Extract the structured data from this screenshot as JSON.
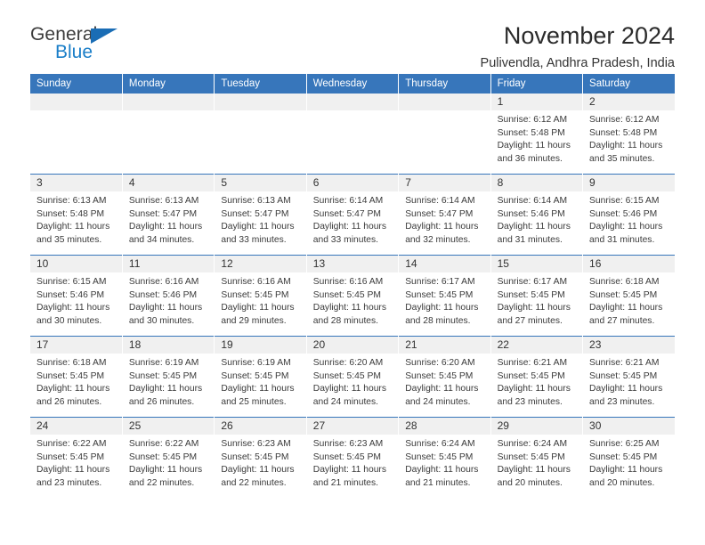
{
  "brand": {
    "name_top": "General",
    "name_bottom": "Blue",
    "triangle_color": "#1a6db5",
    "blue_color": "#1a7ec8"
  },
  "header": {
    "title": "November 2024",
    "subtitle": "Pulivendla, Andhra Pradesh, India"
  },
  "theme": {
    "header_blue": "#3776bb",
    "band_gray": "#f0f0f0"
  },
  "weekday_headers": [
    "Sunday",
    "Monday",
    "Tuesday",
    "Wednesday",
    "Thursday",
    "Friday",
    "Saturday"
  ],
  "weeks": [
    [
      {
        "day": "",
        "sunrise": "",
        "sunset": "",
        "daylight1": "",
        "daylight2": ""
      },
      {
        "day": "",
        "sunrise": "",
        "sunset": "",
        "daylight1": "",
        "daylight2": ""
      },
      {
        "day": "",
        "sunrise": "",
        "sunset": "",
        "daylight1": "",
        "daylight2": ""
      },
      {
        "day": "",
        "sunrise": "",
        "sunset": "",
        "daylight1": "",
        "daylight2": ""
      },
      {
        "day": "",
        "sunrise": "",
        "sunset": "",
        "daylight1": "",
        "daylight2": ""
      },
      {
        "day": "1",
        "sunrise": "Sunrise: 6:12 AM",
        "sunset": "Sunset: 5:48 PM",
        "daylight1": "Daylight: 11 hours",
        "daylight2": "and 36 minutes."
      },
      {
        "day": "2",
        "sunrise": "Sunrise: 6:12 AM",
        "sunset": "Sunset: 5:48 PM",
        "daylight1": "Daylight: 11 hours",
        "daylight2": "and 35 minutes."
      }
    ],
    [
      {
        "day": "3",
        "sunrise": "Sunrise: 6:13 AM",
        "sunset": "Sunset: 5:48 PM",
        "daylight1": "Daylight: 11 hours",
        "daylight2": "and 35 minutes."
      },
      {
        "day": "4",
        "sunrise": "Sunrise: 6:13 AM",
        "sunset": "Sunset: 5:47 PM",
        "daylight1": "Daylight: 11 hours",
        "daylight2": "and 34 minutes."
      },
      {
        "day": "5",
        "sunrise": "Sunrise: 6:13 AM",
        "sunset": "Sunset: 5:47 PM",
        "daylight1": "Daylight: 11 hours",
        "daylight2": "and 33 minutes."
      },
      {
        "day": "6",
        "sunrise": "Sunrise: 6:14 AM",
        "sunset": "Sunset: 5:47 PM",
        "daylight1": "Daylight: 11 hours",
        "daylight2": "and 33 minutes."
      },
      {
        "day": "7",
        "sunrise": "Sunrise: 6:14 AM",
        "sunset": "Sunset: 5:47 PM",
        "daylight1": "Daylight: 11 hours",
        "daylight2": "and 32 minutes."
      },
      {
        "day": "8",
        "sunrise": "Sunrise: 6:14 AM",
        "sunset": "Sunset: 5:46 PM",
        "daylight1": "Daylight: 11 hours",
        "daylight2": "and 31 minutes."
      },
      {
        "day": "9",
        "sunrise": "Sunrise: 6:15 AM",
        "sunset": "Sunset: 5:46 PM",
        "daylight1": "Daylight: 11 hours",
        "daylight2": "and 31 minutes."
      }
    ],
    [
      {
        "day": "10",
        "sunrise": "Sunrise: 6:15 AM",
        "sunset": "Sunset: 5:46 PM",
        "daylight1": "Daylight: 11 hours",
        "daylight2": "and 30 minutes."
      },
      {
        "day": "11",
        "sunrise": "Sunrise: 6:16 AM",
        "sunset": "Sunset: 5:46 PM",
        "daylight1": "Daylight: 11 hours",
        "daylight2": "and 30 minutes."
      },
      {
        "day": "12",
        "sunrise": "Sunrise: 6:16 AM",
        "sunset": "Sunset: 5:45 PM",
        "daylight1": "Daylight: 11 hours",
        "daylight2": "and 29 minutes."
      },
      {
        "day": "13",
        "sunrise": "Sunrise: 6:16 AM",
        "sunset": "Sunset: 5:45 PM",
        "daylight1": "Daylight: 11 hours",
        "daylight2": "and 28 minutes."
      },
      {
        "day": "14",
        "sunrise": "Sunrise: 6:17 AM",
        "sunset": "Sunset: 5:45 PM",
        "daylight1": "Daylight: 11 hours",
        "daylight2": "and 28 minutes."
      },
      {
        "day": "15",
        "sunrise": "Sunrise: 6:17 AM",
        "sunset": "Sunset: 5:45 PM",
        "daylight1": "Daylight: 11 hours",
        "daylight2": "and 27 minutes."
      },
      {
        "day": "16",
        "sunrise": "Sunrise: 6:18 AM",
        "sunset": "Sunset: 5:45 PM",
        "daylight1": "Daylight: 11 hours",
        "daylight2": "and 27 minutes."
      }
    ],
    [
      {
        "day": "17",
        "sunrise": "Sunrise: 6:18 AM",
        "sunset": "Sunset: 5:45 PM",
        "daylight1": "Daylight: 11 hours",
        "daylight2": "and 26 minutes."
      },
      {
        "day": "18",
        "sunrise": "Sunrise: 6:19 AM",
        "sunset": "Sunset: 5:45 PM",
        "daylight1": "Daylight: 11 hours",
        "daylight2": "and 26 minutes."
      },
      {
        "day": "19",
        "sunrise": "Sunrise: 6:19 AM",
        "sunset": "Sunset: 5:45 PM",
        "daylight1": "Daylight: 11 hours",
        "daylight2": "and 25 minutes."
      },
      {
        "day": "20",
        "sunrise": "Sunrise: 6:20 AM",
        "sunset": "Sunset: 5:45 PM",
        "daylight1": "Daylight: 11 hours",
        "daylight2": "and 24 minutes."
      },
      {
        "day": "21",
        "sunrise": "Sunrise: 6:20 AM",
        "sunset": "Sunset: 5:45 PM",
        "daylight1": "Daylight: 11 hours",
        "daylight2": "and 24 minutes."
      },
      {
        "day": "22",
        "sunrise": "Sunrise: 6:21 AM",
        "sunset": "Sunset: 5:45 PM",
        "daylight1": "Daylight: 11 hours",
        "daylight2": "and 23 minutes."
      },
      {
        "day": "23",
        "sunrise": "Sunrise: 6:21 AM",
        "sunset": "Sunset: 5:45 PM",
        "daylight1": "Daylight: 11 hours",
        "daylight2": "and 23 minutes."
      }
    ],
    [
      {
        "day": "24",
        "sunrise": "Sunrise: 6:22 AM",
        "sunset": "Sunset: 5:45 PM",
        "daylight1": "Daylight: 11 hours",
        "daylight2": "and 23 minutes."
      },
      {
        "day": "25",
        "sunrise": "Sunrise: 6:22 AM",
        "sunset": "Sunset: 5:45 PM",
        "daylight1": "Daylight: 11 hours",
        "daylight2": "and 22 minutes."
      },
      {
        "day": "26",
        "sunrise": "Sunrise: 6:23 AM",
        "sunset": "Sunset: 5:45 PM",
        "daylight1": "Daylight: 11 hours",
        "daylight2": "and 22 minutes."
      },
      {
        "day": "27",
        "sunrise": "Sunrise: 6:23 AM",
        "sunset": "Sunset: 5:45 PM",
        "daylight1": "Daylight: 11 hours",
        "daylight2": "and 21 minutes."
      },
      {
        "day": "28",
        "sunrise": "Sunrise: 6:24 AM",
        "sunset": "Sunset: 5:45 PM",
        "daylight1": "Daylight: 11 hours",
        "daylight2": "and 21 minutes."
      },
      {
        "day": "29",
        "sunrise": "Sunrise: 6:24 AM",
        "sunset": "Sunset: 5:45 PM",
        "daylight1": "Daylight: 11 hours",
        "daylight2": "and 20 minutes."
      },
      {
        "day": "30",
        "sunrise": "Sunrise: 6:25 AM",
        "sunset": "Sunset: 5:45 PM",
        "daylight1": "Daylight: 11 hours",
        "daylight2": "and 20 minutes."
      }
    ]
  ]
}
